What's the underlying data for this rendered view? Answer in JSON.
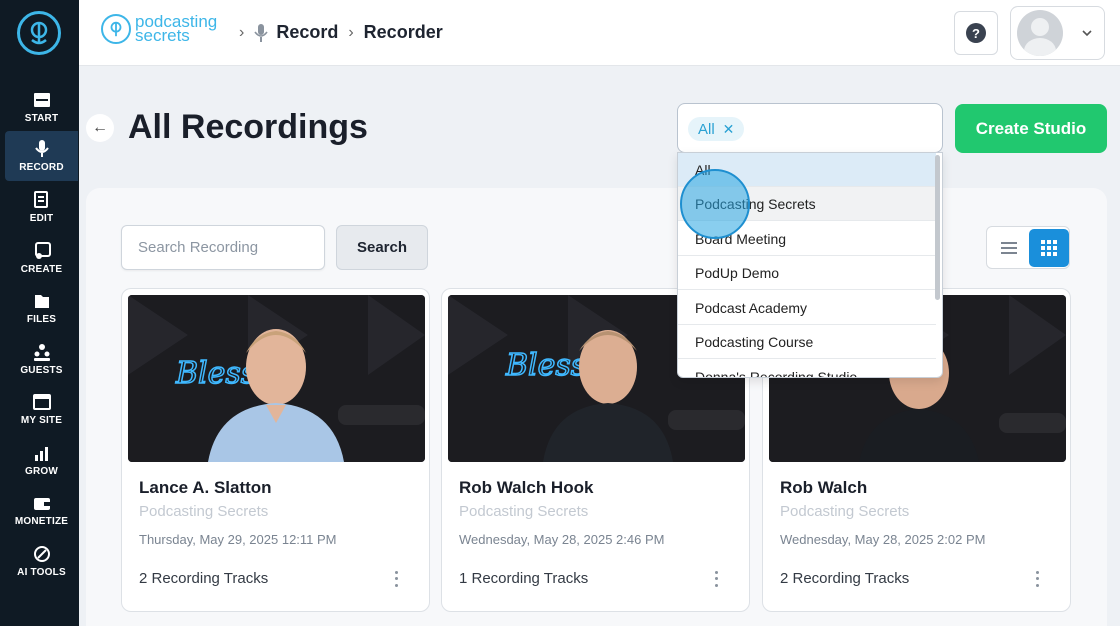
{
  "sidebar": {
    "items": [
      {
        "label": "START",
        "icon": "start-icon"
      },
      {
        "label": "RECORD",
        "icon": "mic-icon",
        "active": true
      },
      {
        "label": "EDIT",
        "icon": "edit-icon"
      },
      {
        "label": "CREATE",
        "icon": "create-icon"
      },
      {
        "label": "FILES",
        "icon": "files-icon"
      },
      {
        "label": "GUESTS",
        "icon": "guests-icon"
      },
      {
        "label": "MY SITE",
        "icon": "site-icon"
      },
      {
        "label": "GROW",
        "icon": "grow-icon"
      },
      {
        "label": "MONETIZE",
        "icon": "monetize-icon"
      },
      {
        "label": "AI TOOLS",
        "icon": "ai-tools-icon"
      }
    ]
  },
  "header": {
    "brand_line1": "podcasting",
    "brand_line2": "secrets",
    "breadcrumb": [
      "Record",
      "Recorder"
    ],
    "help_label": "?"
  },
  "page": {
    "title": "All Recordings",
    "create_label": "Create Studio"
  },
  "filter": {
    "chip_label": "All",
    "options": [
      "All",
      "Podcasting Secrets",
      "Board Meeting",
      "PodUp Demo",
      "Podcast Academy",
      "Podcasting Course",
      "Donna's Recording Studio"
    ],
    "selected": "All",
    "hovered": "Podcasting Secrets"
  },
  "search": {
    "placeholder": "Search Recording",
    "button_label": "Search"
  },
  "recordings": [
    {
      "name": "Lance A. Slatton",
      "studio": "Podcasting Secrets",
      "date": "Thursday, May 29, 2025 12:11 PM",
      "tracks": "2 Recording Tracks"
    },
    {
      "name": "Rob Walch Hook",
      "studio": "Podcasting Secrets",
      "date": "Wednesday, May 28, 2025 2:46 PM",
      "tracks": "1 Recording Tracks"
    },
    {
      "name": "Rob Walch",
      "studio": "Podcasting Secrets",
      "date": "Wednesday, May 28, 2025 2:02 PM",
      "tracks": "2 Recording Tracks"
    }
  ],
  "thumbnail_sign_text": "Blessed",
  "colors": {
    "sidebar_bg": "#0f1a24",
    "accent": "#3db6e8",
    "create_button": "#21c86f",
    "grid_toggle_active": "#1a8fdb"
  }
}
